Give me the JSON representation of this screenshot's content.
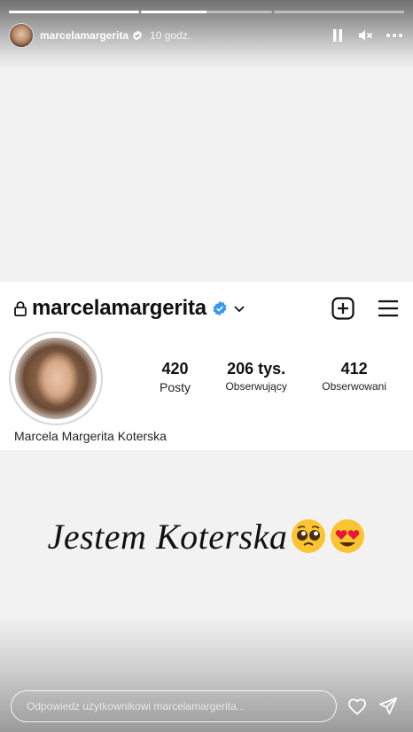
{
  "story": {
    "progress_segments": [
      1.0,
      0.5,
      0.0
    ],
    "username": "marcelamargerita",
    "time": "10 godz.",
    "icons": [
      "pause-icon",
      "mute-icon",
      "more-icon"
    ]
  },
  "profile": {
    "username": "marcelamargerita",
    "full_name": "Marcela Margerita Koterska",
    "stats": [
      {
        "value": "420",
        "label": "Posty"
      },
      {
        "value": "206 tys.",
        "label": "Obserwujący"
      },
      {
        "value": "412",
        "label": "Obserwowani"
      }
    ],
    "icons": [
      "lock-icon",
      "verified-icon",
      "chevron-down-icon",
      "new-post-icon",
      "menu-icon"
    ]
  },
  "caption": {
    "text": "Jestem Koterska",
    "emojis": [
      "pleading-face",
      "heart-eyes-face"
    ]
  },
  "reply": {
    "placeholder": "Odpowiedz użytkownikowi marcelamargerita..."
  },
  "colors": {
    "verified": "#3897f0",
    "emoji_yellow": "#fbc531",
    "heart_red": "#e8173a"
  }
}
